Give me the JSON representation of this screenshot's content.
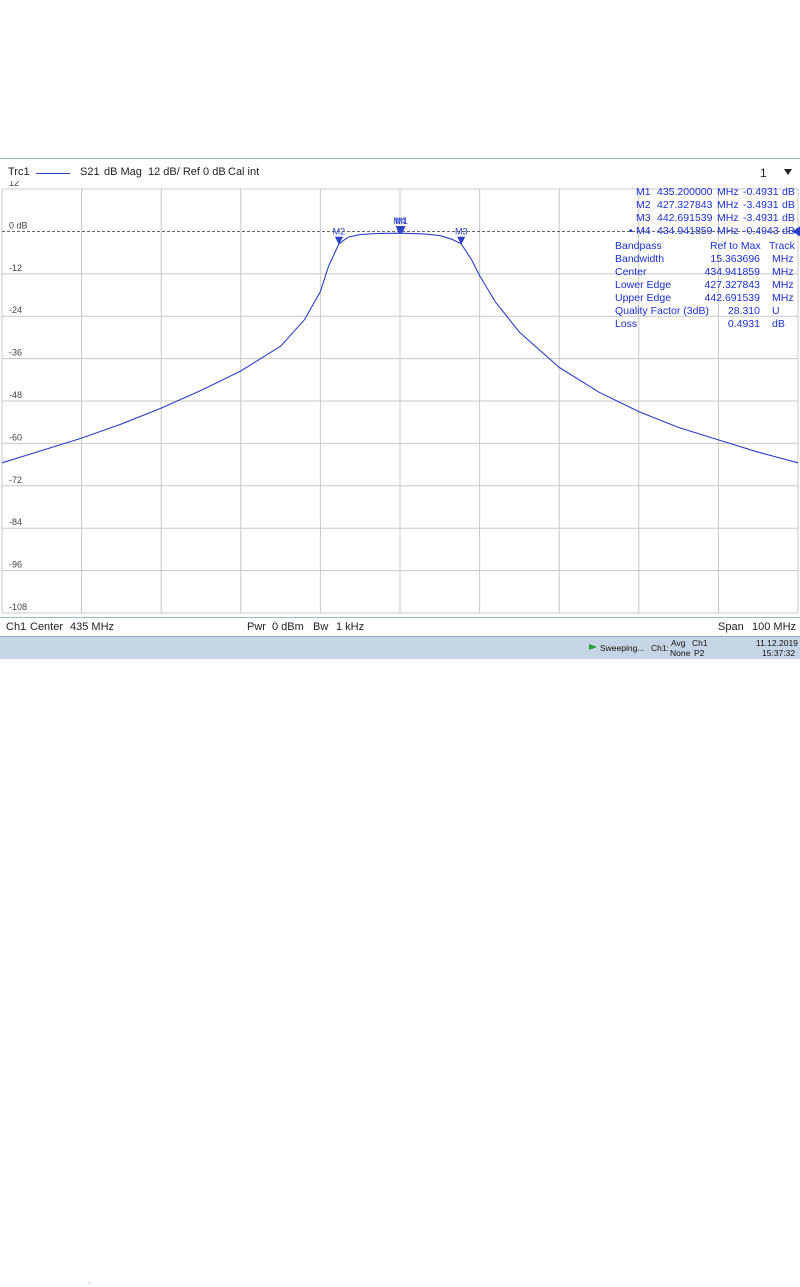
{
  "header": {
    "trace": "Trc1",
    "param": "S21",
    "format": "dB Mag",
    "scale": "12 dB/ Ref 0 dB",
    "cal": "Cal int",
    "channel_num": "1",
    "trace_color": "#2a3fc6"
  },
  "markers": [
    {
      "label": "M1",
      "freq": "435.200000",
      "unit": "MHz",
      "value": "-0.4931",
      "vunit": "dB"
    },
    {
      "label": "M2",
      "freq": "427.327843",
      "unit": "MHz",
      "value": "-3.4931",
      "vunit": "dB"
    },
    {
      "label": "M3",
      "freq": "442.691539",
      "unit": "MHz",
      "value": "-3.4931",
      "vunit": "dB"
    },
    {
      "label": "M4",
      "freq": "434.941859",
      "unit": "MHz",
      "value": "-0.4943",
      "vunit": "dB",
      "active": "•"
    }
  ],
  "bandpass": {
    "title": "Bandpass",
    "mode": "Ref to Max",
    "track": "Track",
    "rows": [
      {
        "name": "Bandwidth",
        "value": "15.363696",
        "unit": "MHz"
      },
      {
        "name": "Center",
        "value": "434.941859",
        "unit": "MHz"
      },
      {
        "name": "Lower Edge",
        "value": "427.327843",
        "unit": "MHz"
      },
      {
        "name": "Upper Edge",
        "value": "442.691539",
        "unit": "MHz"
      },
      {
        "name": "Quality Factor (3dB)",
        "value": "28.310",
        "unit": "U"
      },
      {
        "name": "Loss",
        "value": "0.4931",
        "unit": "dB"
      }
    ]
  },
  "footer": {
    "ch": "Ch1",
    "center_label": "Center",
    "center_value": "435 MHz",
    "pwr_label": "Pwr",
    "pwr_value": "0 dBm",
    "bw_label": "Bw",
    "bw_value": "1 kHz",
    "span_label": "Span",
    "span_value": "100 MHz"
  },
  "status": {
    "sweeping": "Sweeping...",
    "ch": "Ch1:",
    "avg": "Avg",
    "none": "None",
    "ch1": "Ch1",
    "p2": "P2",
    "date": "11.12.2019",
    "time": "15:37:32"
  },
  "chart_data": {
    "type": "line",
    "xlabel": "",
    "ylabel": "",
    "xlim": [
      385,
      485
    ],
    "ylim": [
      -108,
      12
    ],
    "yticks": [
      12,
      0,
      -12,
      -24,
      -36,
      -48,
      -60,
      -72,
      -84,
      -96,
      -108
    ],
    "ytick_labels": [
      "12",
      "0 dB",
      "-12",
      "-24",
      "-36",
      "-48",
      "-60",
      "-72",
      "-84",
      "-96",
      "-108"
    ],
    "reference_line": 0,
    "grid": true,
    "series": [
      {
        "x": [
          385,
          390,
          395,
          400,
          405,
          410,
          415,
          420,
          423,
          425,
          426,
          427.33,
          428.5,
          430,
          432,
          435,
          438,
          440,
          441.5,
          442.69,
          444,
          445,
          447,
          450,
          455,
          460,
          465,
          470,
          475,
          480,
          485
        ],
        "y": [
          -65.5,
          -62,
          -58.5,
          -54.5,
          -50,
          -45,
          -39.5,
          -32.5,
          -25,
          -17,
          -10,
          -3.5,
          -1.6,
          -0.9,
          -0.6,
          -0.5,
          -0.7,
          -1.2,
          -2.2,
          -3.5,
          -8,
          -12.5,
          -20,
          -28.5,
          -38.5,
          -45.5,
          -51,
          -55.5,
          -59,
          -62.5,
          -65.5
        ]
      }
    ],
    "markers": [
      {
        "label": "M1",
        "x": 435.2,
        "y": -0.4931
      },
      {
        "label": "M2",
        "x": 427.327843,
        "y": -3.4931
      },
      {
        "label": "M3",
        "x": 442.691539,
        "y": -3.4931
      },
      {
        "label": "M4",
        "x": 434.941859,
        "y": -0.4943
      }
    ]
  }
}
